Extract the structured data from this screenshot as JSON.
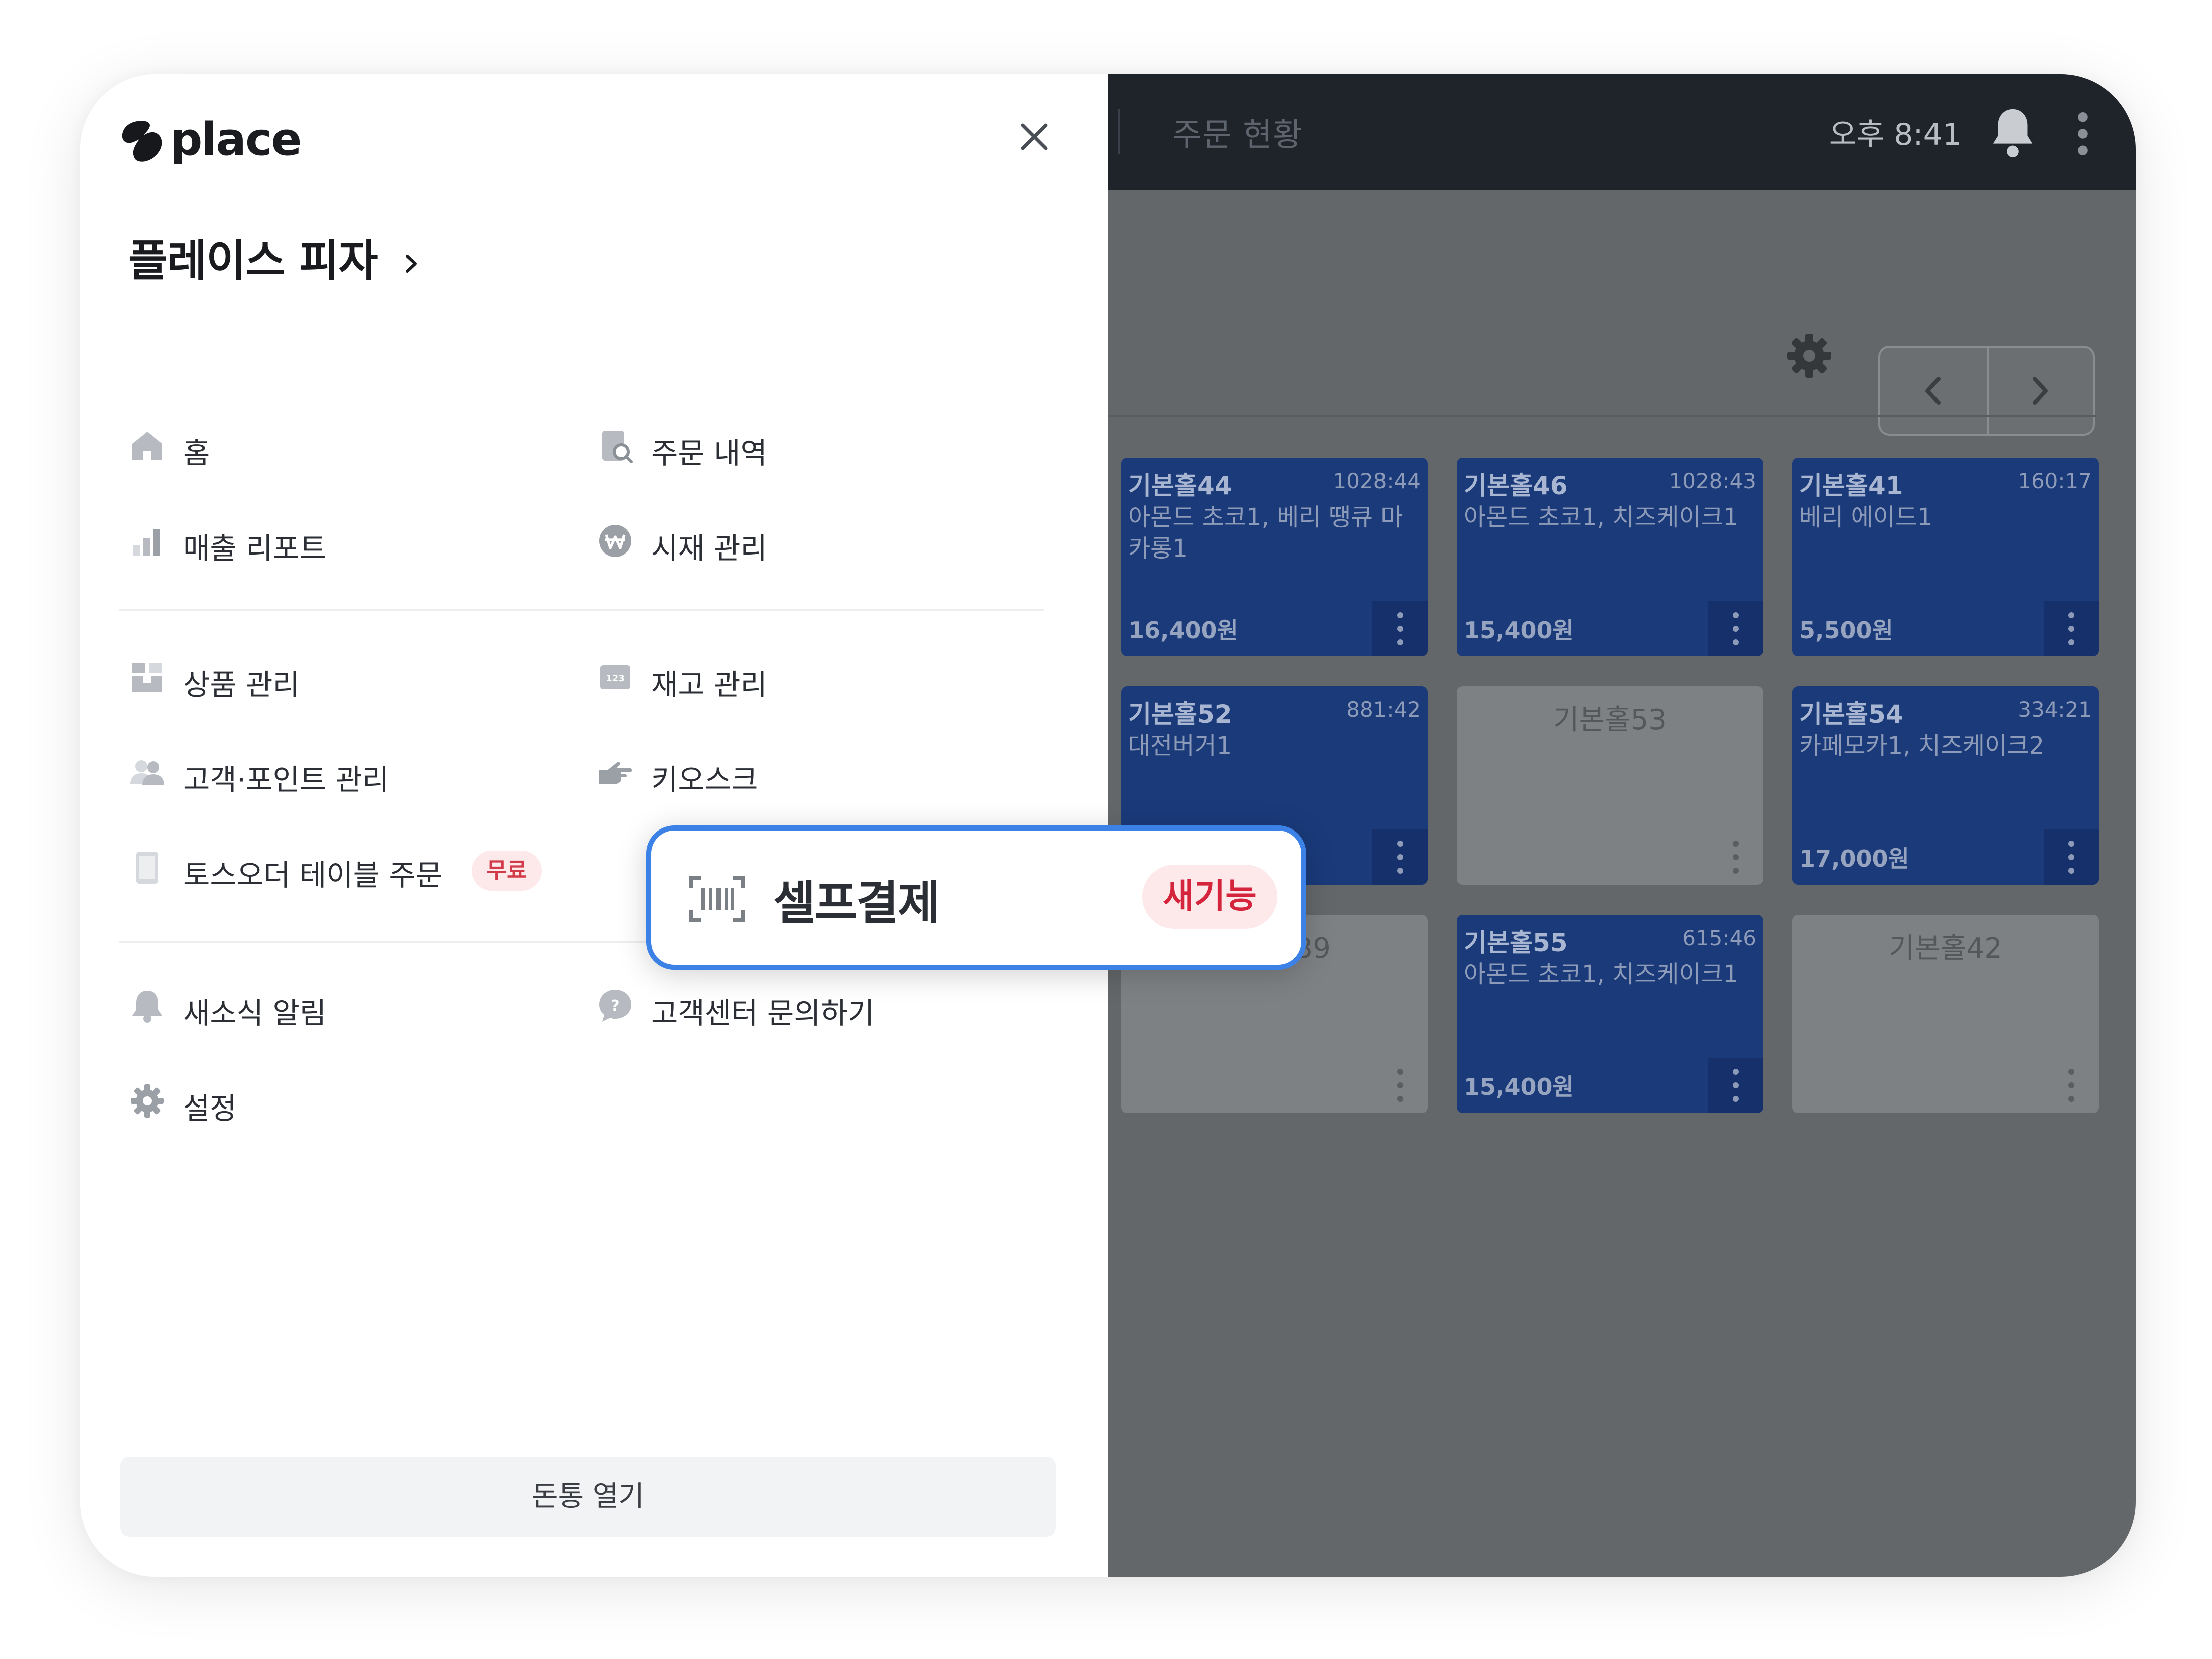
{
  "drawer": {
    "logo_text": "place",
    "store_name": "플레이스 피자",
    "menu_group_1": [
      {
        "label": "홈",
        "icon": "home-icon"
      },
      {
        "label": "주문 내역",
        "icon": "order-history-icon"
      },
      {
        "label": "매출 리포트",
        "icon": "bar-chart-icon"
      },
      {
        "label": "시재 관리",
        "icon": "won-coin-icon"
      }
    ],
    "menu_group_2": [
      {
        "label": "상품 관리",
        "icon": "product-icon"
      },
      {
        "label": "재고 관리",
        "icon": "inventory-icon",
        "icon_text": "123"
      },
      {
        "label": "고객·포인트 관리",
        "icon": "customers-icon"
      },
      {
        "label": "키오스크",
        "icon": "kiosk-hand-icon"
      },
      {
        "label": "토스오더 테이블 주문",
        "icon": "tablet-icon",
        "badge": "무료"
      }
    ],
    "menu_group_3": [
      {
        "label": "새소식 알림",
        "icon": "bell-icon"
      },
      {
        "label": "고객센터 문의하기",
        "icon": "help-icon"
      },
      {
        "label": "설정",
        "icon": "gear-icon"
      }
    ],
    "cash_drawer_button": "돈통 열기"
  },
  "selfpay": {
    "label": "셀프결제",
    "badge": "새기능",
    "icon": "barcode-scan-icon",
    "accent": "#3c82e6"
  },
  "app": {
    "title": "주문 현황",
    "clock": "오후 8:41",
    "tables": [
      {
        "name": "기본홀44",
        "time": "1028:44",
        "items": "아몬드 초코1, 베리 땡큐 마카롱1",
        "price": "16,400원",
        "occupied": true
      },
      {
        "name": "기본홀46",
        "time": "1028:43",
        "items": "아몬드 초코1, 치즈케이크1",
        "price": "15,400원",
        "occupied": true
      },
      {
        "name": "기본홀41",
        "time": "160:17",
        "items": "베리 에이드1",
        "price": "5,500원",
        "occupied": true
      },
      {
        "name": "기본홀52",
        "time": "881:42",
        "items": "대전버거1",
        "price": "",
        "occupied": true
      },
      {
        "name": "기본홀53",
        "time": "",
        "items": "",
        "price": "",
        "occupied": false
      },
      {
        "name": "기본홀54",
        "time": "334:21",
        "items": "카페모카1, 치즈케이크2",
        "price": "17,000원",
        "occupied": true
      },
      {
        "name": "기본홀39",
        "time": "",
        "items": "",
        "price": "",
        "occupied": false
      },
      {
        "name": "기본홀55",
        "time": "615:46",
        "items": "아몬드 초코1, 치즈케이크1",
        "price": "15,400원",
        "occupied": true
      },
      {
        "name": "기본홀42",
        "time": "",
        "items": "",
        "price": "",
        "occupied": false
      }
    ]
  }
}
